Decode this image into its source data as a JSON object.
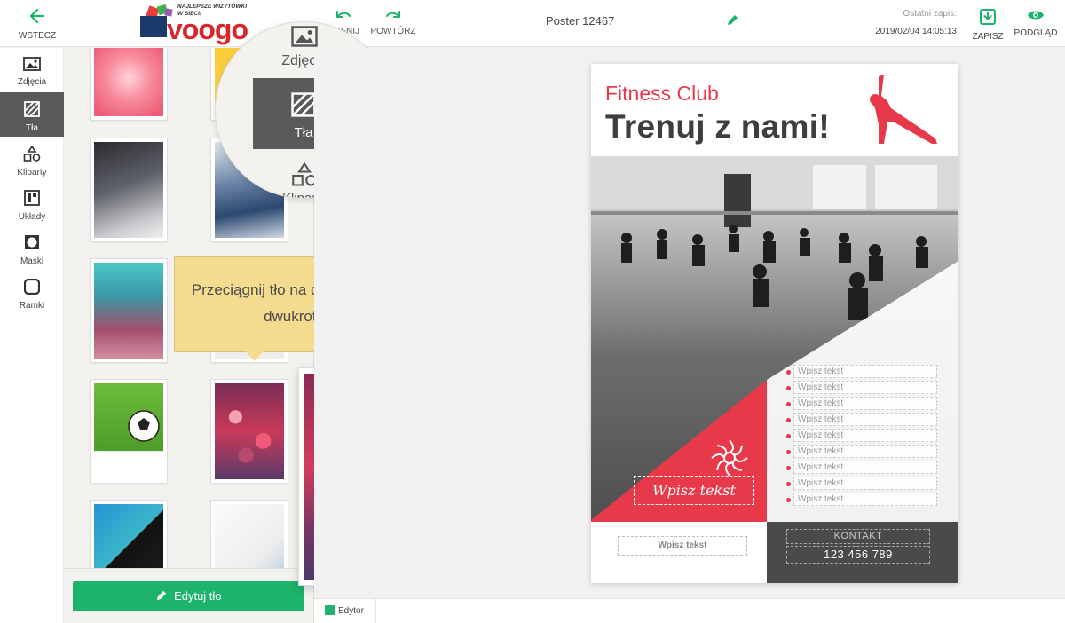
{
  "topbar": {
    "back_label": "WSTECZ",
    "logo_tagline": "NAJLEPSZE WIZYTÓWKI W SIECI!",
    "logo_word": "voogo",
    "undo_label": "COFNIJ",
    "redo_label": "POWTÓRZ",
    "project_name": "Poster 12467",
    "last_save_label": "Ostatni zapis:",
    "last_save_time": "2019/02/04 14:05:13",
    "save_label": "ZAPISZ",
    "preview_label": "PODGLĄD"
  },
  "leftnav": {
    "items": [
      {
        "label": "Zdjęcia",
        "icon": "image-icon"
      },
      {
        "label": "Tła",
        "icon": "background-icon",
        "active": true
      },
      {
        "label": "Kliparty",
        "icon": "shapes-icon"
      },
      {
        "label": "Układy",
        "icon": "layout-icon"
      },
      {
        "label": "Maski",
        "icon": "mask-icon"
      },
      {
        "label": "Ramki",
        "icon": "frame-icon"
      }
    ]
  },
  "magnifier": {
    "photos_label": "Zdjęcia",
    "active_label": "Tła",
    "cliparts_label": "Kliparty"
  },
  "panel": {
    "edit_button_label": "Edytuj tło"
  },
  "tooltip": {
    "text": "Przeciągnij tło na obszar roboczy projektu lub kliknij dwukrotnie na jego miniaturkę"
  },
  "poster": {
    "club": "Fitness Club",
    "headline": "Trenuj z nami!",
    "script_placeholder": "Wpisz tekst",
    "list_placeholders": [
      "Wpisz tekst",
      "Wpisz tekst",
      "Wpisz tekst",
      "Wpisz tekst",
      "Wpisz tekst",
      "Wpisz tekst",
      "Wpisz tekst",
      "Wpisz tekst",
      "Wpisz tekst"
    ],
    "bottom_placeholder": "Wpisz tekst",
    "contact_label": "KONTAKT",
    "phone": "123 456 789"
  },
  "bottom_tabs": {
    "editor_label": "Edytor"
  },
  "colors": {
    "accent": "#1db36b",
    "poster_red": "#e8394b",
    "nav_active": "#5a5a5a",
    "tooltip_bg": "#f3dc90"
  }
}
